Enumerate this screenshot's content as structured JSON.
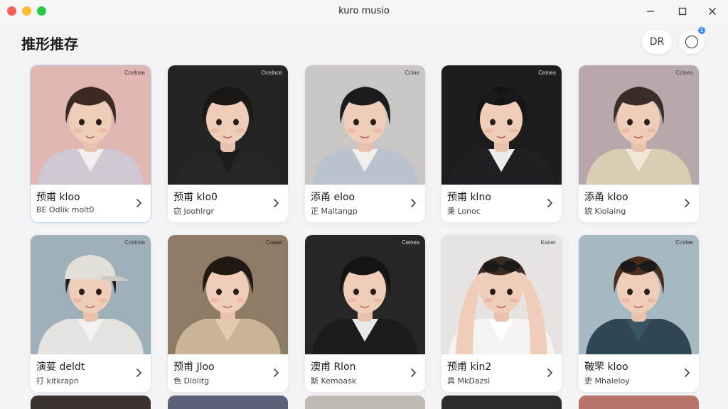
{
  "window": {
    "title": "kuro musio"
  },
  "header": {
    "page_title": "推形推存",
    "profile_button_label": "DR",
    "notification_count": "1"
  },
  "cards": [
    {
      "title": "预甫 kloo",
      "subtitle": "BE Odlik molt0",
      "brand": "Ccelose",
      "bg": "#e0b7b3",
      "hair": "#3b2a24",
      "shirt": "#cfc8d2",
      "shirt2": "#f2efee",
      "brandColor": "#3c2c2c",
      "selected": true
    },
    {
      "title": "预甫 klo0",
      "subtitle": "窃 Joohlrgr",
      "brand": "Ocelnce",
      "bg": "#242424",
      "hair": "#1a1816",
      "shirt": "#262626",
      "shirt2": "#1c1c1c",
      "brandColor": "#dddddd",
      "selected": false
    },
    {
      "title": "添甬 eloo",
      "subtitle": "正 Maltangp",
      "brand": "Cclae",
      "bg": "#c9c6c3",
      "hair": "#1b1b1e",
      "shirt": "#b8c3cf",
      "shirt2": "#f1efec",
      "brandColor": "#444444",
      "selected": false
    },
    {
      "title": "预甫 klno",
      "subtitle": "秉 Lonoc",
      "brand": "Ceines",
      "bg": "#1d1d1d",
      "hair": "#151313",
      "shirt": "#1f2023",
      "shirt2": "#ececec",
      "brandColor": "#dddddd",
      "selected": false
    },
    {
      "title": "添甬 kloo",
      "subtitle": "貌 Kiolaing",
      "brand": "Ccleas",
      "bg": "#b9a8ab",
      "hair": "#3a2c27",
      "shirt": "#d9cdb4",
      "shirt2": "#efe8d6",
      "brandColor": "#444444",
      "selected": false
    },
    {
      "title": "演荽 deldt",
      "subtitle": "打 kitkrapn",
      "brand": "Ccelose",
      "bg": "#9fb0bb",
      "hair": "#1d1a18",
      "shirt": "#e5e3e0",
      "shirt2": "#f3f2f0",
      "brandColor": "#3c3c3c",
      "selected": false
    },
    {
      "title": "预甫 Jloo",
      "subtitle": "色 Dlolitg",
      "brand": "Coase",
      "bg": "#8d7b66",
      "hair": "#201812",
      "shirt": "#cab497",
      "shirt2": "#dfccb1",
      "brandColor": "#2c2c2c",
      "selected": false
    },
    {
      "title": "澳甫 Rlon",
      "subtitle": "斯 Kemoask",
      "brand": "Ceines",
      "bg": "#262626",
      "hair": "#141414",
      "shirt": "#1b1b1d",
      "shirt2": "#e9e9e9",
      "brandColor": "#dddddd",
      "selected": false
    },
    {
      "title": "预甫 kin2",
      "subtitle": "真 MkDazsl",
      "brand": "Kaner",
      "bg": "#e6e3e2",
      "hair": "#3a2a22",
      "shirt": "#f5f4f2",
      "shirt2": "#ffffff",
      "brandColor": "#444444",
      "selected": false
    },
    {
      "title": "鞁罘 kloo",
      "subtitle": "吏 Mhaleloy",
      "brand": "Ccelae",
      "bg": "#a6b9c2",
      "hair": "#4a2d1f",
      "shirt": "#2f4653",
      "shirt2": "#3a5563",
      "brandColor": "#333333",
      "selected": false
    }
  ],
  "partial_row_colors": [
    "#3a3330",
    "#5a6178",
    "#bfbab4",
    "#2c2c2c",
    "#b8746a"
  ]
}
